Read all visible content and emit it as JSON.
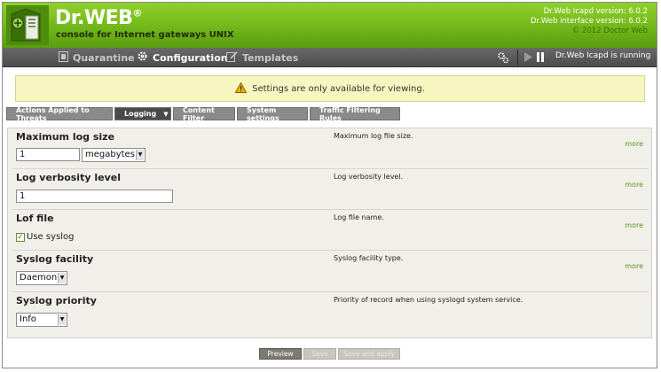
{
  "header": {
    "brand": "Dr.WEB",
    "brand_mark": "®",
    "tagline": "console for Internet gateways UNIX",
    "version_icapd": "Dr.Web Icapd version: 6.0.2",
    "version_interface": "Dr.Web interface version: 6.0.2",
    "copyright": "© 2012 Doctor Web"
  },
  "nav": {
    "items": [
      {
        "label": "Quarantine",
        "icon": "quarantine-icon",
        "active": false
      },
      {
        "label": "Configuration",
        "icon": "gear-icon",
        "active": true
      },
      {
        "label": "Templates",
        "icon": "edit-icon",
        "active": false
      }
    ],
    "status": "Dr.Web Icapd is running"
  },
  "notice": {
    "text": "Settings are only available for viewing.",
    "icon": "warning-icon"
  },
  "tabs": [
    {
      "label": "Actions Applied to Threats",
      "active": false
    },
    {
      "label": "Logging",
      "active": true,
      "caret": "▼"
    },
    {
      "label": "Content Filter",
      "active": false
    },
    {
      "label": "System settings",
      "active": false
    },
    {
      "label": "Traffic Filtering Rules",
      "active": false
    }
  ],
  "settings": {
    "max_log_size": {
      "label": "Maximum log size",
      "value": "1",
      "unit": "megabytes",
      "description": "Maximum log file size.",
      "more": "more"
    },
    "verbosity": {
      "label": "Log verbosity level",
      "value": "1",
      "description": "Log verbosity level.",
      "more": "more"
    },
    "log_file": {
      "label": "Lof file",
      "checkbox_label": "Use syslog",
      "checked": true,
      "description": "Log file name.",
      "more": "more"
    },
    "syslog_facility": {
      "label": "Syslog facility",
      "value": "Daemon",
      "description": "Syslog facility type.",
      "more": "more"
    },
    "syslog_priority": {
      "label": "Syslog priority",
      "value": "Info",
      "description": "Priority of record when using syslogd system service."
    }
  },
  "buttons": {
    "preview": "Preview",
    "save": "Save",
    "save_apply": "Save and apply"
  },
  "colors": {
    "header_green": "#6fb418",
    "nav_gray": "#555555",
    "notice_yellow": "#f7f5c0",
    "link_green": "#5b9a16"
  }
}
